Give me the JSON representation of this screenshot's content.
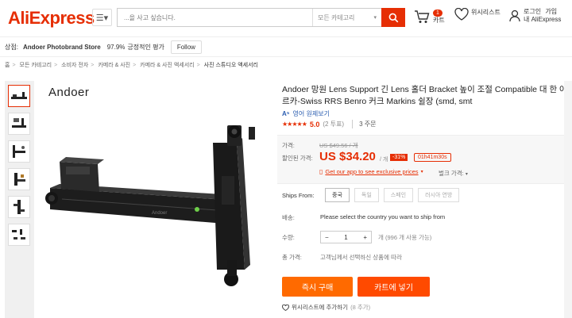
{
  "header": {
    "logo": "AliExpress",
    "search_placeholder": "...을 사고 싶습니다.",
    "search_category": "모든 카테고리",
    "cart_count": "1",
    "cart_label": "카트",
    "wishlist_label": "위시리스트",
    "login_line1": "로그인",
    "join_label": "가입",
    "login_line2": "내 AliExpress"
  },
  "store": {
    "prefix": "상점:",
    "name": "Andoer Photobrand Store",
    "rating": "97.9%",
    "rating_label": "긍정적인 평가",
    "follow": "Follow"
  },
  "breadcrumb": [
    "홈",
    "모든 카테고리",
    "소비자 전자",
    "카메라 & 사진",
    "카메라 & 사진 액세서리",
    "사진 스튜디오 액세서리"
  ],
  "breadcrumb_sep": ">",
  "gallery": {
    "brand": "Andoer"
  },
  "product": {
    "title": "Andoer 망원 Lens Support 긴 Lens 홀더 Bracket 높이 조절 Compatible 대 한 아르카-Swiss RRS Benro 커크 Markins 쉴장 (smd, smt",
    "translate": "영어 원제보기",
    "stars": "★★★★★",
    "score": "5.0",
    "votes": "(2 투표)",
    "orders": "3 주문"
  },
  "price": {
    "orig_label": "가격:",
    "orig_value": "US $49.56 / 개",
    "sale_label": "할인된 가격:",
    "sale_value": "US $34.20",
    "per_unit": "/ 개",
    "discount": "-31%",
    "timer": "01h41m30s",
    "app_link": "Get our app to see exclusive prices",
    "bulk": "벌크 가격:"
  },
  "ships": {
    "label": "Ships From:",
    "options": [
      "중국",
      "독일",
      "스페인",
      "러시아 연방"
    ]
  },
  "shipping": {
    "label": "배송:",
    "value": "Please select the country you want to ship from"
  },
  "quantity": {
    "label": "수량:",
    "minus": "−",
    "value": "1",
    "plus": "+",
    "note": "개 (996 개 사용 가능)"
  },
  "total": {
    "label": "총 가격:",
    "value": "고객님께서 선택하신 상품에 따라"
  },
  "actions": {
    "buy": "즉시 구매",
    "cart": "카트에 넣기",
    "wishlist": "위시리스트에 추가하기",
    "wish_count": "(8 추가)"
  },
  "colors": {
    "accent": "#e62e04",
    "buy": "#ff6a00",
    "cart": "#ff4a00"
  }
}
